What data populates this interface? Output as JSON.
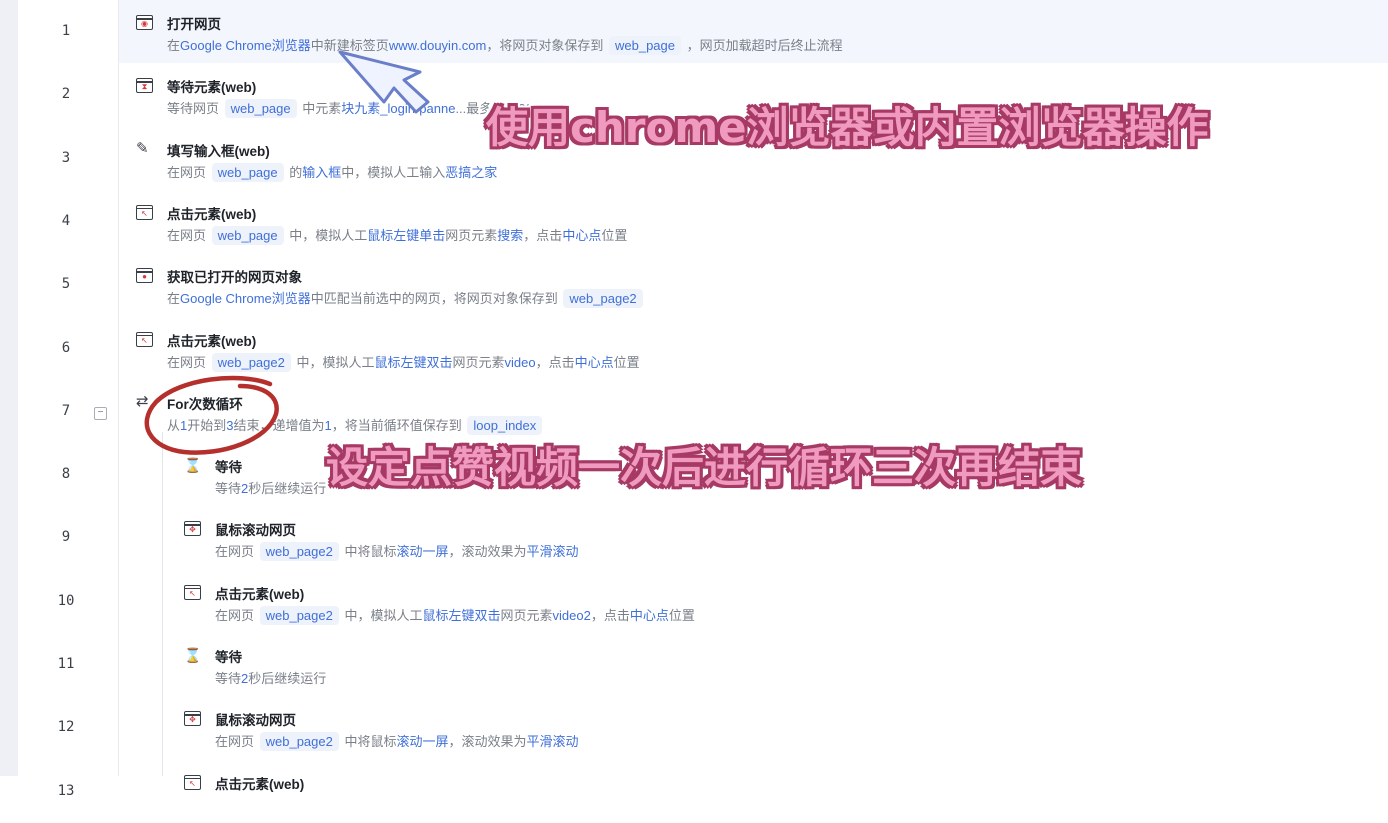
{
  "steps": [
    {
      "line": "1",
      "title": "打开网页",
      "icon": "browser-open-icon",
      "desc": [
        {
          "t": "在"
        },
        {
          "t": "Google Chrome浏览器",
          "c": "hl"
        },
        {
          "t": "中新建标签页"
        },
        {
          "t": "www.douyin.com",
          "c": "hl"
        },
        {
          "t": "，将网页对象保存到 "
        },
        {
          "t": "web_page",
          "c": "chip"
        },
        {
          "t": " ，网页加载超时后终止流程"
        }
      ]
    },
    {
      "line": "2",
      "title": "等待元素(web)",
      "icon": "wait-element-icon",
      "desc": [
        {
          "t": "等待网页 "
        },
        {
          "t": "web_page",
          "c": "chip"
        },
        {
          "t": " 中元素"
        },
        {
          "t": "块九素_login-panne",
          "c": "hl"
        },
        {
          "t": "...最多等待20"
        }
      ]
    },
    {
      "line": "3",
      "title": "填写输入框(web)",
      "icon": "fill-input-icon",
      "desc": [
        {
          "t": "在网页 "
        },
        {
          "t": "web_page",
          "c": "chip"
        },
        {
          "t": " 的"
        },
        {
          "t": "输入框",
          "c": "hl"
        },
        {
          "t": "中，模拟人工输入"
        },
        {
          "t": "恶搞之家",
          "c": "hl"
        }
      ]
    },
    {
      "line": "4",
      "title": "点击元素(web)",
      "icon": "click-element-icon",
      "desc": [
        {
          "t": "在网页 "
        },
        {
          "t": "web_page",
          "c": "chip"
        },
        {
          "t": " 中，模拟人工"
        },
        {
          "t": "鼠标左键单击",
          "c": "hl"
        },
        {
          "t": "网页元素"
        },
        {
          "t": "搜索",
          "c": "hl"
        },
        {
          "t": "，点击"
        },
        {
          "t": "中心点",
          "c": "hl"
        },
        {
          "t": "位置"
        }
      ]
    },
    {
      "line": "5",
      "title": "获取已打开的网页对象",
      "icon": "get-page-icon",
      "desc": [
        {
          "t": "在"
        },
        {
          "t": "Google Chrome浏览器",
          "c": "hl"
        },
        {
          "t": "中匹配当前选中的网页，将网页对象保存到 "
        },
        {
          "t": "web_page2",
          "c": "chip"
        }
      ]
    },
    {
      "line": "6",
      "title": "点击元素(web)",
      "icon": "click-element-icon",
      "desc": [
        {
          "t": "在网页 "
        },
        {
          "t": "web_page2",
          "c": "chip"
        },
        {
          "t": " 中，模拟人工"
        },
        {
          "t": "鼠标左键双击",
          "c": "hl"
        },
        {
          "t": "网页元素"
        },
        {
          "t": "video",
          "c": "hl"
        },
        {
          "t": "，点击"
        },
        {
          "t": "中心点",
          "c": "hl"
        },
        {
          "t": "位置"
        }
      ]
    },
    {
      "line": "7",
      "title": "For次数循环",
      "icon": "loop-icon",
      "collapse": "−",
      "desc": [
        {
          "t": "从"
        },
        {
          "t": "1",
          "c": "hl"
        },
        {
          "t": "开始到"
        },
        {
          "t": "3",
          "c": "hl"
        },
        {
          "t": "结束，递增值为"
        },
        {
          "t": "1",
          "c": "hl"
        },
        {
          "t": "，将当前循环值保存到 "
        },
        {
          "t": "loop_index",
          "c": "chip"
        }
      ]
    },
    {
      "line": "8",
      "title": "等待",
      "icon": "hourglass-icon",
      "desc": [
        {
          "t": "等待"
        },
        {
          "t": "2",
          "c": "hl"
        },
        {
          "t": "秒后继续运行"
        }
      ]
    },
    {
      "line": "9",
      "title": "鼠标滚动网页",
      "icon": "scroll-page-icon",
      "desc": [
        {
          "t": "在网页 "
        },
        {
          "t": "web_page2",
          "c": "chip"
        },
        {
          "t": " 中将鼠标"
        },
        {
          "t": "滚动一屏",
          "c": "hl"
        },
        {
          "t": "，滚动效果为"
        },
        {
          "t": "平滑滚动",
          "c": "hl"
        }
      ]
    },
    {
      "line": "10",
      "title": "点击元素(web)",
      "icon": "click-element-icon",
      "desc": [
        {
          "t": "在网页 "
        },
        {
          "t": "web_page2",
          "c": "chip"
        },
        {
          "t": " 中，模拟人工"
        },
        {
          "t": "鼠标左键双击",
          "c": "hl"
        },
        {
          "t": "网页元素"
        },
        {
          "t": "video2",
          "c": "hl"
        },
        {
          "t": "，点击"
        },
        {
          "t": "中心点",
          "c": "hl"
        },
        {
          "t": "位置"
        }
      ]
    },
    {
      "line": "11",
      "title": "等待",
      "icon": "hourglass-icon",
      "desc": [
        {
          "t": "等待"
        },
        {
          "t": "2",
          "c": "hl"
        },
        {
          "t": "秒后继续运行"
        }
      ]
    },
    {
      "line": "12",
      "title": "鼠标滚动网页",
      "icon": "scroll-page-icon",
      "desc": [
        {
          "t": "在网页 "
        },
        {
          "t": "web_page2",
          "c": "chip"
        },
        {
          "t": " 中将鼠标"
        },
        {
          "t": "滚动一屏",
          "c": "hl"
        },
        {
          "t": "，滚动效果为"
        },
        {
          "t": "平滑滚动",
          "c": "hl"
        }
      ]
    },
    {
      "line": "13",
      "title": "点击元素(web)",
      "icon": "click-element-icon",
      "desc": []
    }
  ],
  "annotations": {
    "browser_note": "使用chrome浏览器或内置浏览器操作",
    "loop_note": "设定点赞视频一次后进行循环三次再结束"
  },
  "colors": {
    "accent": "#3f6fd8",
    "annotation_fill": "#f09abf",
    "annotation_stroke": "#a63a64",
    "circle": "#b5302c"
  }
}
